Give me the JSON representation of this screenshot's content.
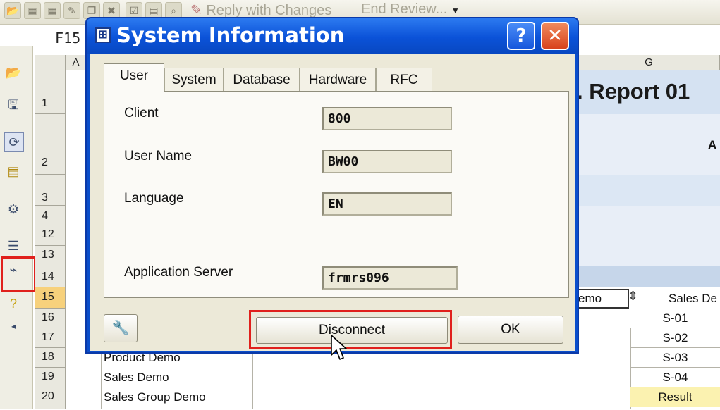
{
  "toolbar": {
    "reply_with_changes": "Reply with Changes",
    "end_review": "End Review..."
  },
  "formula_bar": {
    "name_box": "F15"
  },
  "sheet": {
    "column_headers": [
      "A",
      "G"
    ],
    "row_headers": [
      "1",
      "2",
      "3",
      "4",
      "12",
      "13",
      "14",
      "15",
      "16",
      "17",
      "18",
      "19",
      "20"
    ],
    "report_title": ". Report 01",
    "g2_text": "A",
    "f15_text": "emo",
    "g15_text": "Sales De",
    "g_values": [
      "S-01",
      "S-02",
      "S-03",
      "S-04",
      "Result"
    ],
    "b_values": [
      "Product Demo",
      "Sales Demo",
      "Sales Group Demo"
    ]
  },
  "dialog": {
    "title": "System Information",
    "help_glyph": "?",
    "close_glyph": "✕",
    "tabs": [
      "User",
      "System",
      "Database",
      "Hardware",
      "RFC"
    ],
    "active_tab": "User",
    "fields": [
      {
        "label": "Client",
        "value": "800"
      },
      {
        "label": "User Name",
        "value": "BW00"
      },
      {
        "label": "Language",
        "value": "EN"
      },
      {
        "label": "Application Server",
        "value": "frmrs096"
      }
    ],
    "disconnect_label": "Disconnect",
    "ok_label": "OK"
  },
  "colors": {
    "title_blue": "#0b52d8",
    "close_red": "#e2522a",
    "highlight_red": "#e0201c",
    "dialog_face": "#ece9d8"
  },
  "icons": {
    "title": "app-window-icon",
    "tools": "wrench-screwdriver-icon",
    "cursor": "mouse-pointer-icon",
    "disconnect_tool": "disconnect-plug-icon"
  }
}
